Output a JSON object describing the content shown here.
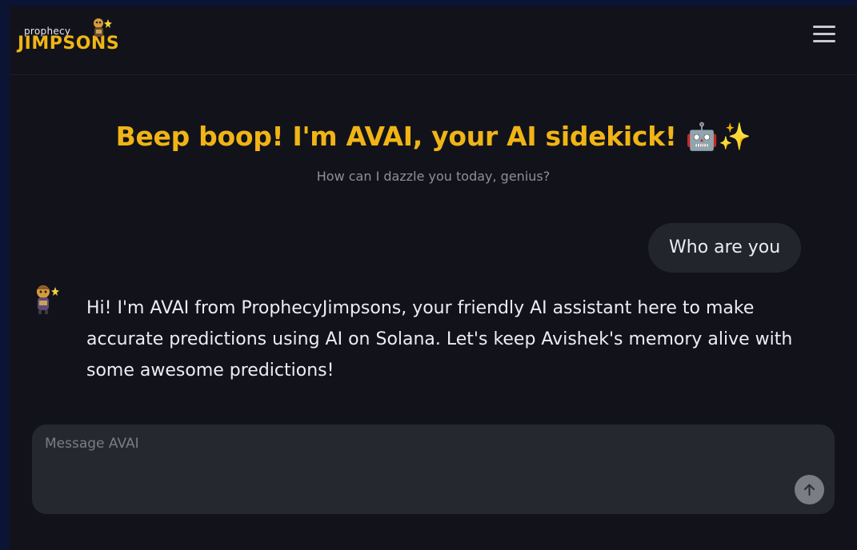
{
  "header": {
    "logo_top": "prophecy",
    "logo_main": "JIMPSONS",
    "menu_icon": "hamburger-menu-icon"
  },
  "hero": {
    "title": "Beep boop! I'm AVAI, your AI sidekick! 🤖✨",
    "subtitle": "How can I dazzle you today, genius?"
  },
  "conversation": {
    "messages": [
      {
        "role": "user",
        "text": "Who are you"
      },
      {
        "role": "assistant",
        "avatar_icon": "jimpson-mascot-avatar-icon",
        "text": "Hi! I'm AVAI from ProphecyJimpsons, your friendly AI assistant here to make accurate predictions using AI on Solana. Let's keep Avishek's memory alive with some awesome predictions!"
      }
    ]
  },
  "composer": {
    "placeholder": "Message AVAI",
    "value": "",
    "send_icon": "arrow-up-icon"
  },
  "colors": {
    "accent": "#f0b416",
    "background": "#12131a",
    "bubble": "#23252d",
    "composer": "#262830"
  }
}
